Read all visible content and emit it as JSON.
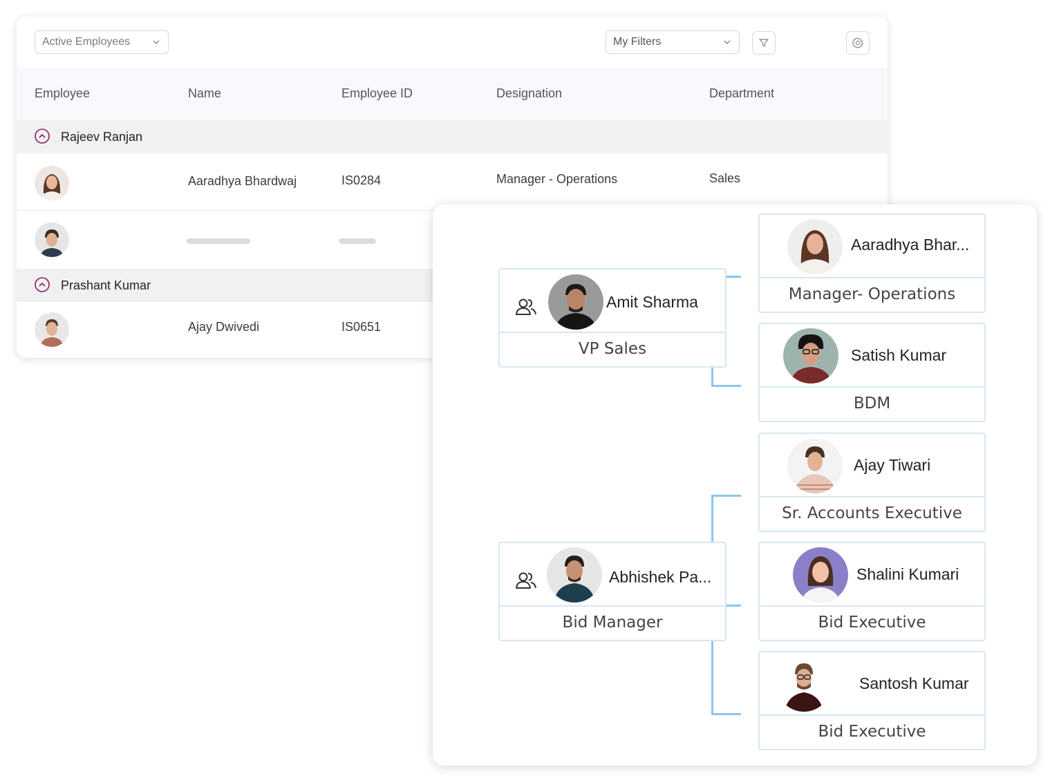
{
  "table": {
    "view_select": {
      "value": "Active Employees"
    },
    "filters_select": {
      "value": "My Filters"
    },
    "columns": [
      "Employee",
      "Name",
      "Employee ID",
      "Designation",
      "Department"
    ],
    "groups": [
      {
        "manager": "Rajeev Ranjan",
        "rows": [
          {
            "name": "Aaradhya Bhardwaj",
            "employee_id": "IS0284",
            "designation": "Manager - Operations",
            "department": "Sales"
          }
        ]
      },
      {
        "manager": "Prashant Kumar",
        "rows": [
          {
            "name": "Ajay Dwivedi",
            "employee_id": "IS0651",
            "designation": "",
            "department": ""
          }
        ]
      }
    ]
  },
  "org_chart": {
    "managers": [
      {
        "name": "Amit Sharma",
        "title": "VP Sales"
      },
      {
        "name": "Abhishek Pa...",
        "title": "Bid Manager"
      }
    ],
    "reports": [
      {
        "name": "Aaradhya Bhar...",
        "title": "Manager- Operations"
      },
      {
        "name": "Satish Kumar",
        "title": "BDM"
      },
      {
        "name": "Ajay Tiwari",
        "title": "Sr. Accounts Executive"
      },
      {
        "name": "Shalini Kumari",
        "title": "Bid Executive"
      },
      {
        "name": "Santosh Kumar",
        "title": "Bid Executive"
      }
    ]
  },
  "colors": {
    "accent": "#8a1a63",
    "connector": "#8cc4ef",
    "node_border": "#d7e6f5",
    "header_bg": "#f7f9fc",
    "group_bg": "#f1f1f1"
  },
  "icons": [
    "chevron-down-icon",
    "filter-icon",
    "gear-icon",
    "collapse-icon",
    "team-icon"
  ]
}
